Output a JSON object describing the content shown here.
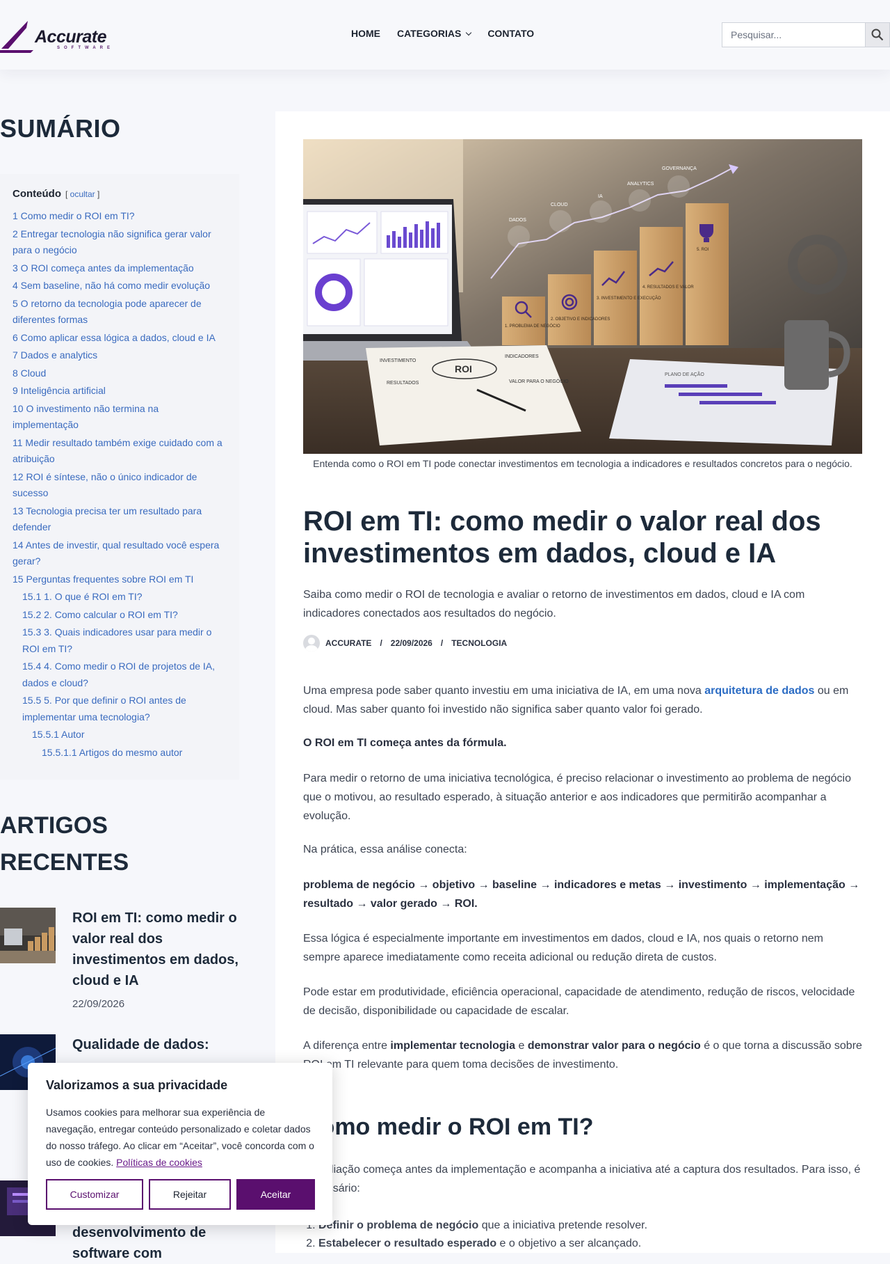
{
  "header": {
    "logo_name": "Accurate",
    "logo_sub": "SOFTWARE",
    "nav": [
      "HOME",
      "CATEGORIAS",
      "CONTATO"
    ],
    "search_placeholder": "Pesquisar..."
  },
  "sidebar": {
    "sumario_title": "SUMÁRIO",
    "toc_heading": "Conteúdo",
    "toc_hide": "ocultar",
    "toc": [
      {
        "label": "1  Como medir o ROI em TI?",
        "level": 1
      },
      {
        "label": "2  Entregar tecnologia não significa gerar valor para o negócio",
        "level": 1
      },
      {
        "label": "3  O ROI começa antes da implementação",
        "level": 1
      },
      {
        "label": "4  Sem baseline, não há como medir evolução",
        "level": 1
      },
      {
        "label": "5  O retorno da tecnologia pode aparecer de diferentes formas",
        "level": 1
      },
      {
        "label": "6  Como aplicar essa lógica a dados, cloud e IA",
        "level": 1
      },
      {
        "label": "7  Dados e analytics",
        "level": 1
      },
      {
        "label": "8  Cloud",
        "level": 1
      },
      {
        "label": "9  Inteligência artificial",
        "level": 1
      },
      {
        "label": "10  O investimento não termina na implementação",
        "level": 1
      },
      {
        "label": "11  Medir resultado também exige cuidado com a atribuição",
        "level": 1
      },
      {
        "label": "12  ROI é síntese, não o único indicador de sucesso",
        "level": 1
      },
      {
        "label": "13  Tecnologia precisa ter um resultado para defender",
        "level": 1
      },
      {
        "label": "14  Antes de investir, qual resultado você espera gerar?",
        "level": 1
      },
      {
        "label": "15  Perguntas frequentes sobre ROI em TI",
        "level": 1
      },
      {
        "label": "15.1  1. O que é ROI em TI?",
        "level": 2
      },
      {
        "label": "15.2  2. Como calcular o ROI em TI?",
        "level": 2
      },
      {
        "label": "15.3  3. Quais indicadores usar para medir o ROI em TI?",
        "level": 2
      },
      {
        "label": "15.4  4. Como medir o ROI de projetos de IA, dados e cloud?",
        "level": 2
      },
      {
        "label": "15.5  5. Por que definir o ROI antes de implementar uma tecnologia?",
        "level": 2
      },
      {
        "label": "15.5.1  Autor",
        "level": 3
      },
      {
        "label": "15.5.1.1  Artigos do mesmo autor",
        "level": 4
      }
    ],
    "recent_title": "ARTIGOS RECENTES",
    "recent": [
      {
        "title": "ROI em TI: como medir o valor real dos investimentos em dados, cloud e IA",
        "date": "22/09/2026"
      },
      {
        "title": "Qualidade de dados:",
        "date": ""
      },
      {
        "title": "desenvolvimento de software com",
        "date": ""
      }
    ]
  },
  "article": {
    "caption": "Entenda como o ROI em TI pode conectar investimentos em tecnologia a indicadores e resultados concretos para o negócio.",
    "title": "ROI em TI: como medir o valor real dos investimentos em dados, cloud e IA",
    "lead": "Saiba como medir o ROI de tecnologia e avaliar o retorno de investimentos em dados, cloud e IA com indicadores conectados aos resultados do negócio.",
    "author": "ACCURATE",
    "date": "22/09/2026",
    "category": "TECNOLOGIA",
    "p1_a": "Uma empresa pode saber quanto investiu em uma iniciativa de IA, em uma nova ",
    "p1_link": "arquitetura de dados",
    "p1_b": " ou em cloud. Mas saber quanto foi investido não significa saber quanto valor foi gerado.",
    "p2": "O ROI em TI começa antes da fórmula.",
    "p3": "Para medir o retorno de uma iniciativa tecnológica, é preciso relacionar o investimento ao problema de negócio que o motivou, ao resultado esperado, à situação anterior e aos indicadores que permitirão acompanhar a evolução.",
    "p4": "Na prática, essa análise conecta:",
    "p5": "problema de negócio → objetivo → baseline → indicadores e metas → investimento → implementação → resultado → valor gerado → ROI.",
    "p6": "Essa lógica é especialmente importante em investimentos em dados, cloud e IA, nos quais o retorno nem sempre aparece imediatamente como receita adicional ou redução direta de custos.",
    "p7": "Pode estar em produtividade, eficiência operacional, capacidade de atendimento, redução de riscos, velocidade de decisão, disponibilidade ou capacidade de escalar.",
    "p8_a": "A diferença entre ",
    "p8_b1": "implementar tecnologia",
    "p8_c": " e ",
    "p8_b2": "demonstrar valor para o negócio",
    "p8_d": " é o que torna a discussão sobre ROI em TI relevante para quem toma decisões de investimento.",
    "h2": "Como medir o ROI em TI?",
    "p9": "A avaliação começa antes da implementação e acompanha a iniciativa até a captura dos resultados. Para isso, é necessário:",
    "list": [
      {
        "bold": "Definir o problema de negócio",
        "rest": " que a iniciativa pretende resolver."
      },
      {
        "bold": "Estabelecer o resultado esperado",
        "rest": " e o objetivo a ser alcançado."
      }
    ]
  },
  "hero_labels": {
    "dados": "DADOS",
    "cloud": "CLOUD",
    "ia": "IA",
    "analytics": "ANALYTICS",
    "governanca": "GOVERNANÇA",
    "b1": "1. PROBLEMA DE NEGÓCIO",
    "b2": "2. OBJETIVO E INDICADORES",
    "b3": "3. INVESTIMENTO E EXECUÇÃO",
    "b4": "4. RESULTADOS E VALOR",
    "b5": "5. ROI",
    "roi": "ROI",
    "inv": "INVESTIMENTO",
    "ind": "INDICADORES",
    "res": "RESULTADOS",
    "val": "VALOR PARA O NEGÓCIO",
    "plan": "PLANO DE AÇÃO"
  },
  "cookie": {
    "title": "Valorizamos a sua privacidade",
    "text": "Usamos cookies para melhorar sua experiência de navegação, entregar conteúdo personalizado e coletar dados do nosso tráfego. Ao clicar em “Aceitar”, você concorda com o uso de cookies. ",
    "link": "Políticas de cookies",
    "customize": "Customizar",
    "reject": "Rejeitar",
    "accept": "Aceitar"
  },
  "colors": {
    "brand": "#5a0f6e",
    "link": "#3a6bbf",
    "heading": "#1d2a3a"
  }
}
